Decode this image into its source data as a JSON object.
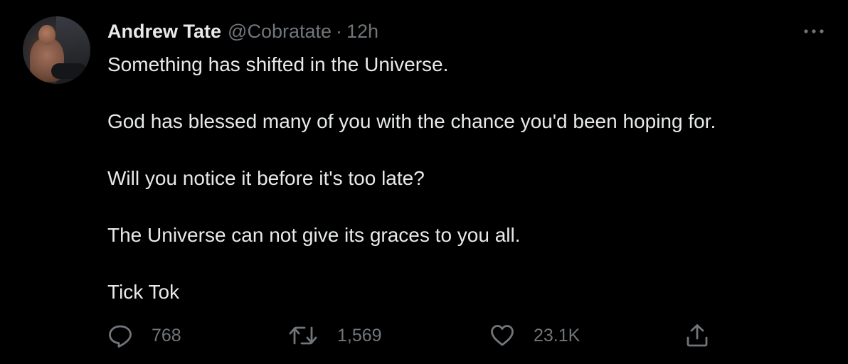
{
  "tweet": {
    "author": {
      "name": "Andrew Tate",
      "handle": "@Cobratate",
      "separator": "·",
      "time": "12h",
      "avatar_icon": "profile-photo-avatar"
    },
    "more_icon": "more-horizontal-icon",
    "text_lines": [
      "Something has shifted in the Universe.",
      "God has blessed many of you with the chance you'd been hoping for.",
      "Will you notice it before it's too late?",
      "The Universe can not give its graces to you all.",
      "Tick Tok"
    ],
    "actions": {
      "reply": {
        "icon": "reply-bubble-icon",
        "count": "768"
      },
      "retweet": {
        "icon": "retweet-icon",
        "count": "1,569"
      },
      "like": {
        "icon": "heart-icon",
        "count": "23.1K"
      },
      "share": {
        "icon": "share-upload-icon"
      }
    },
    "colors": {
      "background": "#000000",
      "primary_text": "#e7e9ea",
      "secondary_text": "#71767b"
    }
  }
}
